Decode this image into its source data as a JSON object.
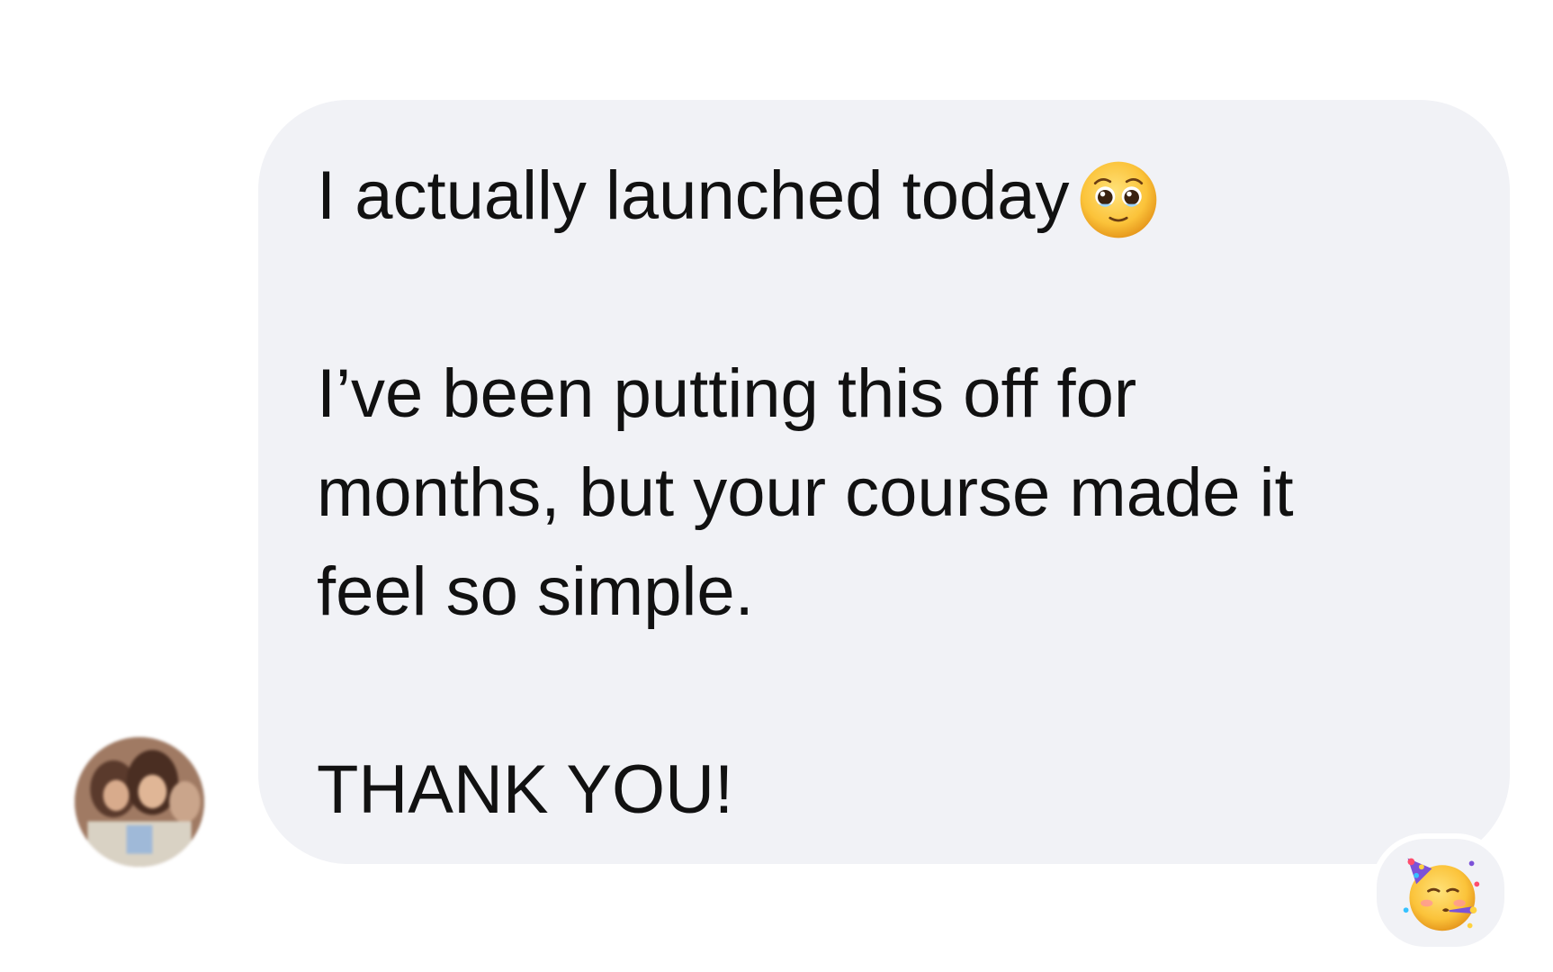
{
  "message": {
    "line1": "I actually launched today",
    "line1_emoji": "pleading-face-icon",
    "paragraph2": [
      "I’ve been putting this off for",
      "months, but your course made it",
      "feel so simple."
    ],
    "closing": "THANK YOU!"
  },
  "reaction": {
    "emoji": "partying-face-icon"
  },
  "colors": {
    "bubble_background": "#f1f2f6",
    "text": "#111111",
    "page_background": "#ffffff"
  }
}
